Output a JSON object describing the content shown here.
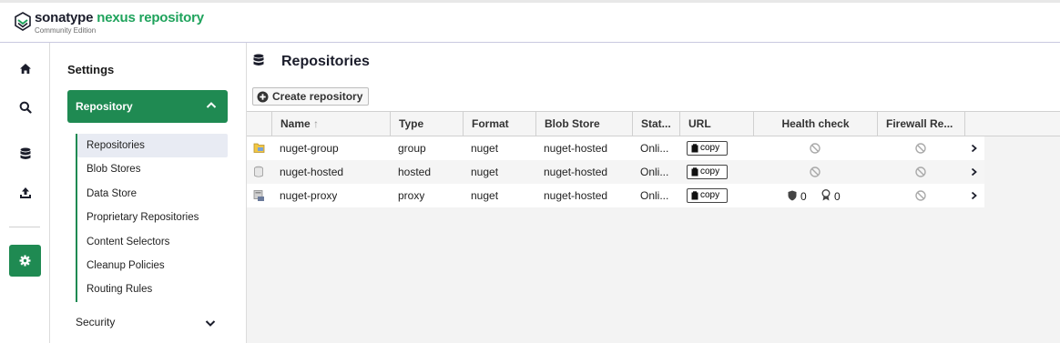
{
  "app": {
    "brand_part1": "sonatype",
    "brand_part2": "nexus repository",
    "edition": "Community Edition",
    "brand_color": "#1f8a52"
  },
  "rail": {
    "items": [
      "home-icon",
      "search-icon",
      "database-icon",
      "upload-icon",
      "gear-icon"
    ],
    "active": "gear-icon"
  },
  "settings": {
    "title": "Settings",
    "repository_group": "Repository",
    "items": [
      "Repositories",
      "Blob Stores",
      "Data Store",
      "Proprietary Repositories",
      "Content Selectors",
      "Cleanup Policies",
      "Routing Rules"
    ],
    "selected_item": "Repositories",
    "security_group": "Security"
  },
  "main": {
    "title": "Repositories",
    "create_button": "Create repository",
    "columns": [
      "Name",
      "Type",
      "Format",
      "Blob Store",
      "Stat...",
      "URL",
      "Health check",
      "Firewall Re..."
    ],
    "sort_indicator": "↑",
    "rows": [
      {
        "icon": "group-repo-icon",
        "name": "nuget-group",
        "type": "group",
        "format": "nuget",
        "blob_store": "nuget-hosted",
        "status": "Onli...",
        "copy": "copy",
        "health": "disabled",
        "firewall": "disabled"
      },
      {
        "icon": "hosted-repo-icon",
        "name": "nuget-hosted",
        "type": "hosted",
        "format": "nuget",
        "blob_store": "nuget-hosted",
        "status": "Onli...",
        "copy": "copy",
        "health": "disabled",
        "firewall": "disabled"
      },
      {
        "icon": "proxy-repo-icon",
        "name": "nuget-proxy",
        "type": "proxy",
        "format": "nuget",
        "blob_store": "nuget-hosted",
        "status": "Onli...",
        "copy": "copy",
        "health_security": "0",
        "health_license": "0",
        "firewall": "disabled"
      }
    ]
  }
}
